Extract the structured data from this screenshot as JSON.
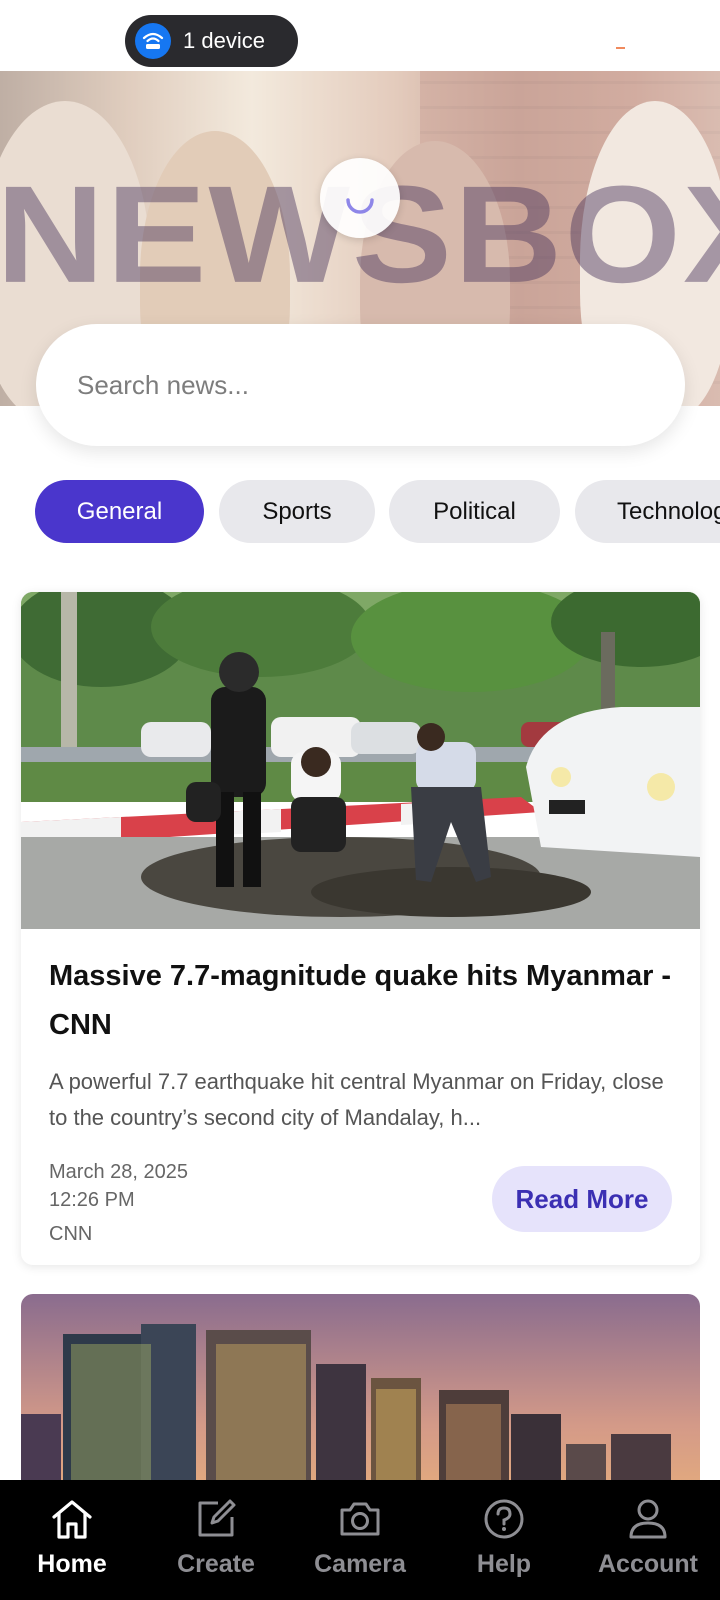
{
  "status_bar": {
    "device_pill_label": "1 device",
    "icons": [
      "wifi-router-icon"
    ]
  },
  "hero": {
    "logo_text": "NEWSBOX",
    "loading": true
  },
  "search": {
    "placeholder": "Search news..."
  },
  "categories": [
    {
      "label": "General",
      "active": true
    },
    {
      "label": "Sports",
      "active": false
    },
    {
      "label": "Political",
      "active": false
    },
    {
      "label": "Technolog",
      "active": false
    }
  ],
  "articles": [
    {
      "title": "Massive 7.7-magnitude quake hits Myanmar - CNN",
      "description": "A powerful 7.7 earthquake hit central Myanmar on Friday, close to the country’s second city of Mandalay, h...",
      "date": "March 28, 2025",
      "time": "12:26 PM",
      "source": "CNN",
      "read_more_label": "Read More"
    }
  ],
  "bottom_nav": [
    {
      "label": "Home",
      "icon": "home-icon",
      "active": true
    },
    {
      "label": "Create",
      "icon": "edit-icon",
      "active": false
    },
    {
      "label": "Camera",
      "icon": "camera-icon",
      "active": false
    },
    {
      "label": "Help",
      "icon": "help-icon",
      "active": false
    },
    {
      "label": "Account",
      "icon": "account-icon",
      "active": false
    }
  ],
  "colors": {
    "accent": "#4a36cc",
    "accent_light": "#e6e3fb",
    "chip_inactive": "#e8e8ec",
    "nav_bg": "#000000",
    "nav_inactive": "#8e8e93",
    "device_icon_bg": "#1677f2"
  }
}
